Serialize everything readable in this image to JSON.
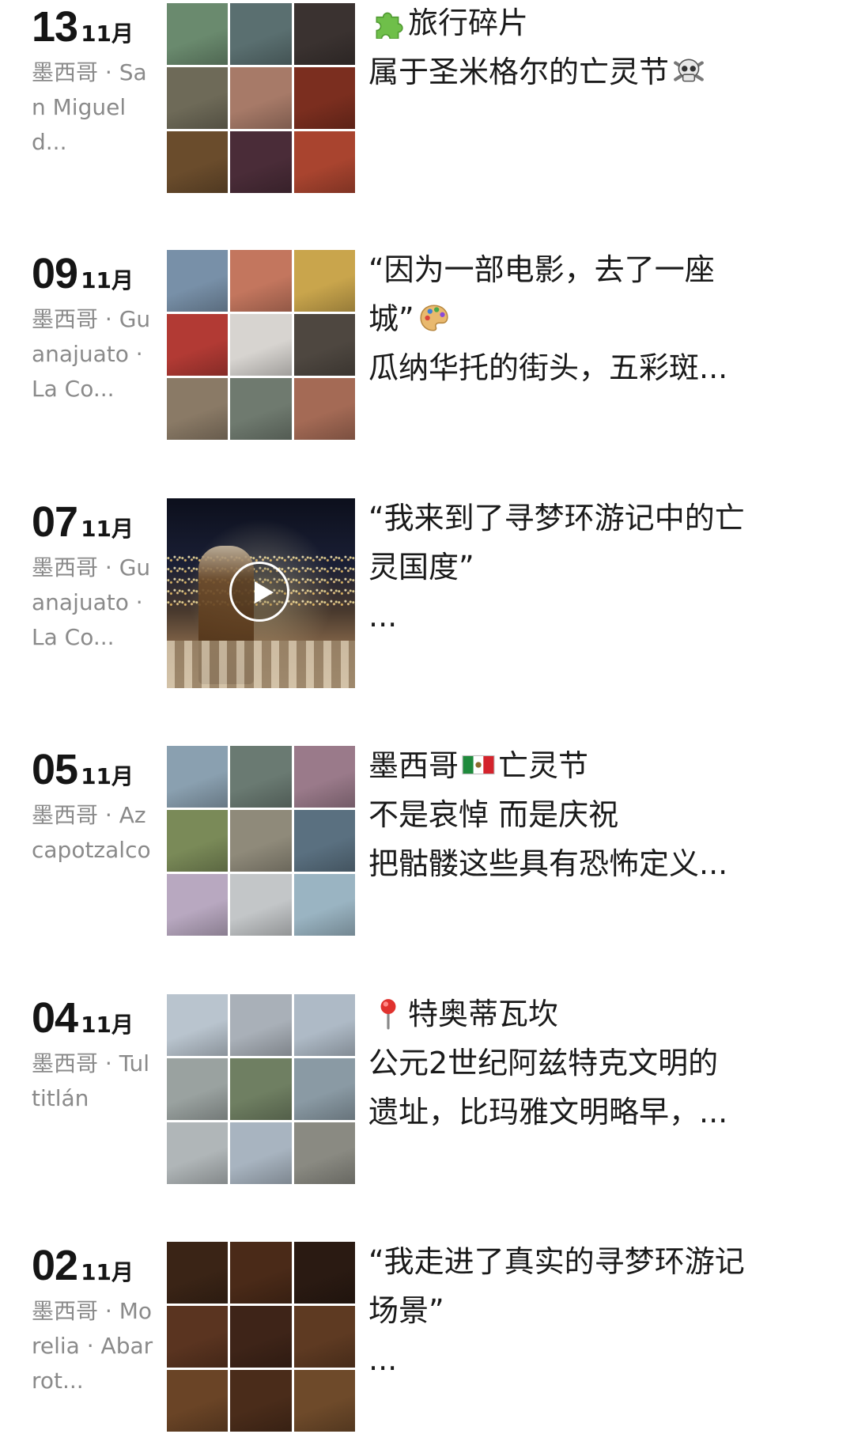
{
  "posts": [
    {
      "day": "13",
      "month": "11月",
      "location": "墨西哥 · San Miguel d...",
      "media": "grid",
      "thumbs": [
        "#6a8a6e",
        "#5a6f70",
        "#3a3230",
        "#6e6a58",
        "#a77a68",
        "#7b2e1f",
        "#6a4c2c",
        "#4a2c38",
        "#a9442f"
      ],
      "lines": [
        {
          "pre_icon": "puzzle-icon",
          "text": "旅行碎片"
        },
        {
          "text": "属于圣米格尔的亡灵节",
          "post_icon": "skull-icon"
        }
      ]
    },
    {
      "day": "09",
      "month": "11月",
      "location": "墨西哥 · Guanajuato · La Co...",
      "media": "grid",
      "thumbs": [
        "#7890a8",
        "#c3765e",
        "#c9a54c",
        "#b23a34",
        "#d7d4d0",
        "#4e4740",
        "#8a7a66",
        "#6f7a6f",
        "#a46a55"
      ],
      "lines": [
        {
          "text": "“因为一部电影，去了一座"
        },
        {
          "text": "城”",
          "post_icon": "palette-icon"
        },
        {
          "text": "瓜纳华托的街头，五彩斑..."
        }
      ]
    },
    {
      "day": "07",
      "month": "11月",
      "location": "墨西哥 · Guanajuato · La Co...",
      "media": "video",
      "lines": [
        {
          "text": "“我来到了寻梦环游记中的亡"
        },
        {
          "text": "灵国度”"
        },
        {
          "text": "..."
        }
      ]
    },
    {
      "day": "05",
      "month": "11月",
      "location": "墨西哥 · Azcapotzalco",
      "media": "grid",
      "thumbs": [
        "#8aa0b0",
        "#6a7a72",
        "#9a7a8a",
        "#7a8a58",
        "#8f8a7a",
        "#5a7080",
        "#b8a8c0",
        "#c3c6c8",
        "#9ab4c2"
      ],
      "lines": [
        {
          "text": "墨西哥",
          "post_icon": "mexico-flag-icon",
          "post_text": "亡灵节"
        },
        {
          "text": "不是哀悼 而是庆祝"
        },
        {
          "text": "把骷髅这些具有恐怖定义..."
        }
      ]
    },
    {
      "day": "04",
      "month": "11月",
      "location": "墨西哥 · Tultitlán",
      "media": "grid",
      "thumbs": [
        "#b9c4ce",
        "#a9b0b8",
        "#aebac6",
        "#9aa2a0",
        "#6f7f62",
        "#8a9aa4",
        "#b0b6b8",
        "#a8b4c0",
        "#8a8a82"
      ],
      "lines": [
        {
          "pre_icon": "pin-icon",
          "text": "特奥蒂瓦坎"
        },
        {
          "text": "公元2世纪阿兹特克文明的"
        },
        {
          "text": "遗址，比玛雅文明略早，..."
        }
      ]
    },
    {
      "day": "02",
      "month": "11月",
      "location": "墨西哥 · Morelia · Abarrot...",
      "media": "grid",
      "thumbs": [
        "#3a2416",
        "#4a2a18",
        "#2a1a12",
        "#5a3420",
        "#3e2418",
        "#5e3a22",
        "#6a4426",
        "#4a2c1a",
        "#6e4a2a"
      ],
      "lines": [
        {
          "text": "“我走进了真实的寻梦环游记"
        },
        {
          "text": "场景”"
        },
        {
          "text": "..."
        }
      ]
    }
  ]
}
